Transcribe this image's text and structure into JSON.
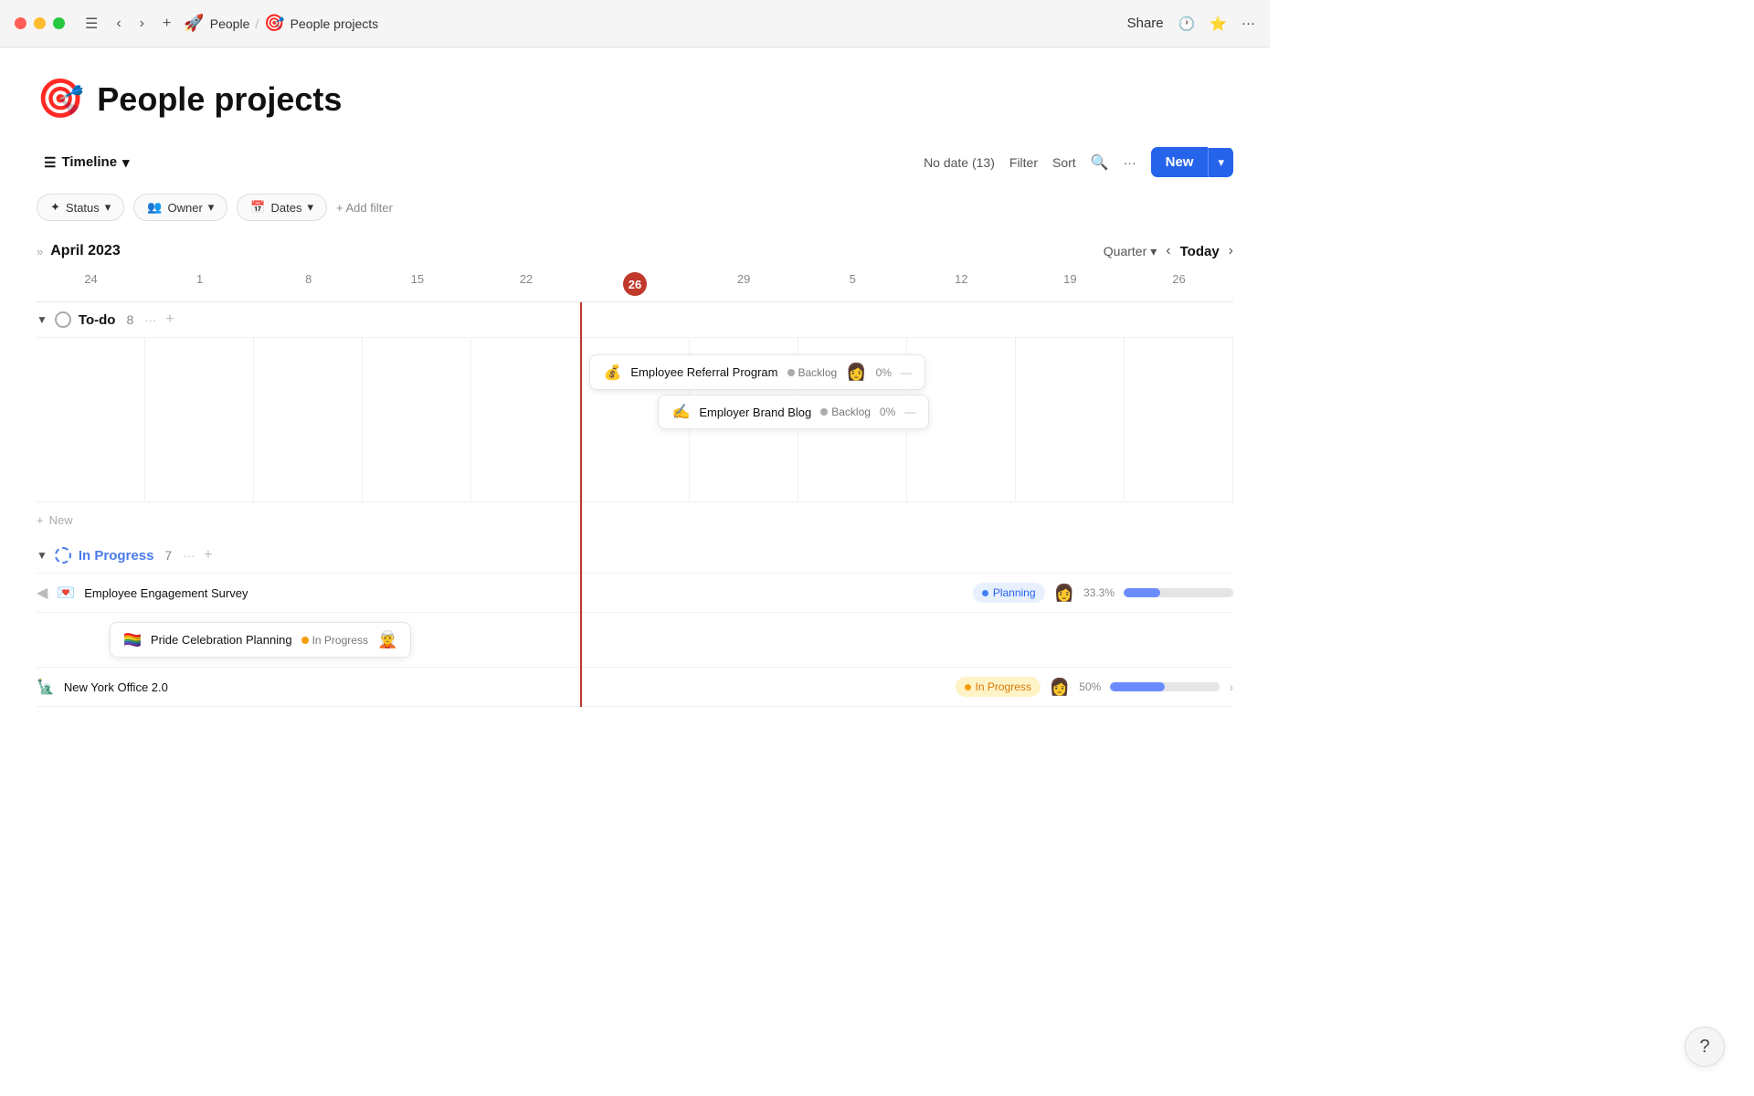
{
  "titlebar": {
    "breadcrumb_people": "People",
    "separator": "/",
    "breadcrumb_page": "People projects",
    "share_label": "Share",
    "more_label": "···"
  },
  "page": {
    "title": "People projects",
    "icon": "🎯"
  },
  "toolbar": {
    "view_label": "Timeline",
    "no_date_label": "No date (13)",
    "filter_label": "Filter",
    "sort_label": "Sort",
    "more_label": "···",
    "new_label": "New"
  },
  "filters": {
    "status_label": "Status",
    "owner_label": "Owner",
    "dates_label": "Dates",
    "add_filter_label": "+ Add filter"
  },
  "timeline": {
    "month": "April 2023",
    "quarter_label": "Quarter",
    "today_label": "Today",
    "dates": [
      "24",
      "1",
      "8",
      "15",
      "22",
      "26",
      "29",
      "5",
      "12",
      "19",
      "26"
    ],
    "today_date": "26"
  },
  "groups": {
    "todo": {
      "label": "To-do",
      "count": "8"
    },
    "in_progress": {
      "label": "In Progress",
      "count": "7"
    }
  },
  "task_cards": [
    {
      "icon": "💰",
      "name": "Employee Referral Program",
      "status": "Backlog",
      "pct": "0%"
    },
    {
      "icon": "✍️",
      "name": "Employer Brand Blog",
      "status": "Backlog",
      "pct": "0%"
    }
  ],
  "new_row_label": "+ New",
  "task_rows": [
    {
      "icon": "💌",
      "name": "Employee Engagement Survey",
      "status": "Planning",
      "status_type": "blue",
      "pct": "33.3%",
      "fill": 33
    },
    {
      "icon": "🏳️‍🌈",
      "name": "Pride Celebration Planning",
      "status": "In Progress",
      "status_type": "orange",
      "pct": ""
    },
    {
      "icon": "🗽",
      "name": "New York Office 2.0",
      "status": "In Progress",
      "status_type": "orange",
      "pct": "50%",
      "fill": 50
    }
  ],
  "help_label": "?"
}
